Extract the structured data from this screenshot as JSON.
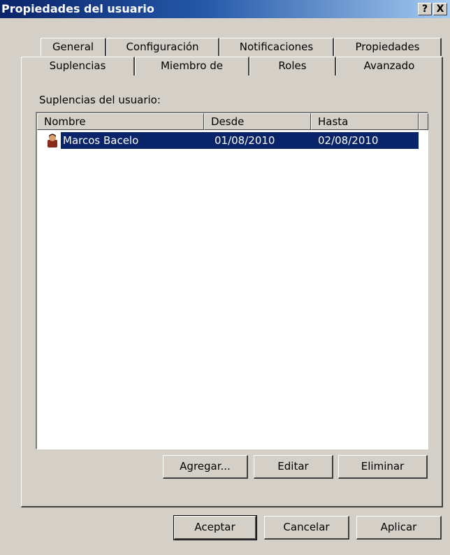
{
  "window": {
    "title": "Propiedades del usuario",
    "help_glyph": "?",
    "close_glyph": "X"
  },
  "tabs_back_row": [
    "General",
    "Configuración",
    "Notificaciones",
    "Propiedades"
  ],
  "tabs_front_row": [
    "Suplencias",
    "Miembro de",
    "Roles",
    "Avanzado"
  ],
  "active_tab": "Suplencias",
  "section_label": "Suplencias del usuario:",
  "table": {
    "columns": [
      "Nombre",
      "Desde",
      "Hasta"
    ],
    "rows": [
      {
        "name": "Marcos Bacelo",
        "from": "01/08/2010",
        "to": "02/08/2010",
        "selected": true,
        "icon": "user-icon"
      }
    ]
  },
  "actions": {
    "add": "Agregar...",
    "edit": "Editar",
    "delete": "Eliminar"
  },
  "dialog": {
    "ok": "Aceptar",
    "cancel": "Cancelar",
    "apply": "Aplicar"
  },
  "colors": {
    "titlebar": "#0a246a",
    "selection": "#0a246a",
    "face": "#d4d0c8"
  }
}
